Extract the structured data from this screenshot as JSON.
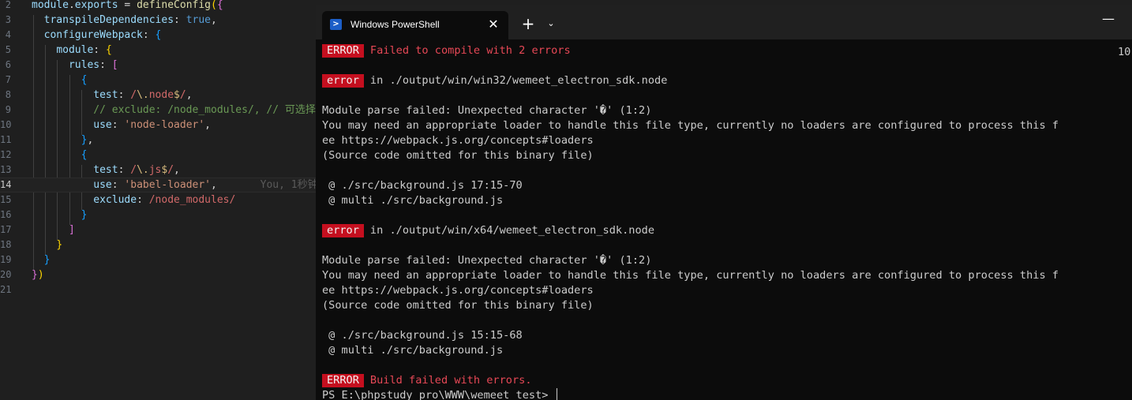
{
  "editor": {
    "lines": [
      {
        "num": "2",
        "segs": [
          [
            "tk-var",
            "module"
          ],
          [
            "tk-pun",
            "."
          ],
          [
            "tk-var",
            "exports"
          ],
          [
            "tk-pun",
            " = "
          ],
          [
            "tk-fn",
            "defineConfig"
          ],
          [
            "tk-b1",
            "("
          ],
          [
            "tk-b2",
            "{"
          ]
        ]
      },
      {
        "num": "3",
        "segs": [
          [
            "tk-pun",
            "  "
          ],
          [
            "tk-var",
            "transpileDependencies"
          ],
          [
            "tk-pun",
            ": "
          ],
          [
            "tk-kw",
            "true"
          ],
          [
            "tk-pun",
            ","
          ]
        ]
      },
      {
        "num": "4",
        "segs": [
          [
            "tk-pun",
            "  "
          ],
          [
            "tk-var",
            "configureWebpack"
          ],
          [
            "tk-pun",
            ": "
          ],
          [
            "tk-b3",
            "{"
          ]
        ]
      },
      {
        "num": "5",
        "segs": [
          [
            "tk-pun",
            "    "
          ],
          [
            "tk-var",
            "module"
          ],
          [
            "tk-pun",
            ": "
          ],
          [
            "tk-b1",
            "{"
          ]
        ]
      },
      {
        "num": "6",
        "segs": [
          [
            "tk-pun",
            "      "
          ],
          [
            "tk-var",
            "rules"
          ],
          [
            "tk-pun",
            ": "
          ],
          [
            "tk-b2",
            "["
          ]
        ]
      },
      {
        "num": "7",
        "segs": [
          [
            "tk-pun",
            "        "
          ],
          [
            "tk-b3",
            "{"
          ]
        ]
      },
      {
        "num": "8",
        "segs": [
          [
            "tk-pun",
            "          "
          ],
          [
            "tk-var",
            "test"
          ],
          [
            "tk-pun",
            ": "
          ],
          [
            "tk-re",
            "/"
          ],
          [
            "tk-esc",
            "\\."
          ],
          [
            "tk-re",
            "node"
          ],
          [
            "tk-esc",
            "$"
          ],
          [
            "tk-re",
            "/"
          ],
          [
            "tk-pun",
            ","
          ]
        ]
      },
      {
        "num": "9",
        "segs": [
          [
            "tk-pun",
            "          "
          ],
          [
            "tk-cmt",
            "// exclude: /node_modules/, // 可选择"
          ]
        ]
      },
      {
        "num": "10",
        "segs": [
          [
            "tk-pun",
            "          "
          ],
          [
            "tk-var",
            "use"
          ],
          [
            "tk-pun",
            ": "
          ],
          [
            "tk-str",
            "'node-loader'"
          ],
          [
            "tk-pun",
            ","
          ]
        ]
      },
      {
        "num": "11",
        "segs": [
          [
            "tk-pun",
            "        "
          ],
          [
            "tk-b3",
            "}"
          ],
          [
            "tk-pun",
            ","
          ]
        ]
      },
      {
        "num": "12",
        "segs": [
          [
            "tk-pun",
            "        "
          ],
          [
            "tk-b3",
            "{"
          ]
        ]
      },
      {
        "num": "13",
        "segs": [
          [
            "tk-pun",
            "          "
          ],
          [
            "tk-var",
            "test"
          ],
          [
            "tk-pun",
            ": "
          ],
          [
            "tk-re",
            "/"
          ],
          [
            "tk-esc",
            "\\."
          ],
          [
            "tk-re",
            "js"
          ],
          [
            "tk-esc",
            "$"
          ],
          [
            "tk-re",
            "/"
          ],
          [
            "tk-pun",
            ","
          ]
        ]
      },
      {
        "num": "14",
        "segs": [
          [
            "tk-pun",
            "          "
          ],
          [
            "tk-var",
            "use"
          ],
          [
            "tk-pun",
            ": "
          ],
          [
            "tk-str",
            "'babel-loader'"
          ],
          [
            "tk-pun",
            ",       "
          ],
          [
            "blame",
            "You, 1秒钟"
          ]
        ]
      },
      {
        "num": "15",
        "segs": [
          [
            "tk-pun",
            "          "
          ],
          [
            "tk-var",
            "exclude"
          ],
          [
            "tk-pun",
            ": "
          ],
          [
            "tk-re",
            "/node_modules/"
          ]
        ]
      },
      {
        "num": "16",
        "segs": [
          [
            "tk-pun",
            "        "
          ],
          [
            "tk-b3",
            "}"
          ]
        ]
      },
      {
        "num": "17",
        "segs": [
          [
            "tk-pun",
            "      "
          ],
          [
            "tk-b2",
            "]"
          ]
        ]
      },
      {
        "num": "18",
        "segs": [
          [
            "tk-pun",
            "    "
          ],
          [
            "tk-b1",
            "}"
          ]
        ]
      },
      {
        "num": "19",
        "segs": [
          [
            "tk-pun",
            "  "
          ],
          [
            "tk-b3",
            "}"
          ]
        ]
      },
      {
        "num": "20",
        "segs": [
          [
            "tk-b2",
            "}"
          ],
          [
            "tk-b1",
            ")"
          ]
        ]
      },
      {
        "num": "21",
        "segs": []
      }
    ]
  },
  "terminal": {
    "tab_title": "Windows PowerShell",
    "tab_icon": "powershell-icon",
    "close_glyph": "✕",
    "new_tab_glyph": "+",
    "dropdown_glyph": "⌄",
    "minimize_glyph": "—",
    "right_number": "10",
    "lines": [
      {
        "badge": "ERROR",
        "text": "Failed to compile with 2 errors",
        "red": true
      },
      {
        "text": ""
      },
      {
        "badge": "error",
        "text": "in ./output/win/win32/wemeet_electron_sdk.node"
      },
      {
        "text": ""
      },
      {
        "text": "Module parse failed: Unexpected character '�' (1:2)"
      },
      {
        "text": "You may need an appropriate loader to handle this file type, currently no loaders are configured to process this f"
      },
      {
        "text": "ee https://webpack.js.org/concepts#loaders"
      },
      {
        "text": "(Source code omitted for this binary file)"
      },
      {
        "text": ""
      },
      {
        "text": " @ ./src/background.js 17:15-70"
      },
      {
        "text": " @ multi ./src/background.js"
      },
      {
        "text": ""
      },
      {
        "badge": "error",
        "text": "in ./output/win/x64/wemeet_electron_sdk.node"
      },
      {
        "text": ""
      },
      {
        "text": "Module parse failed: Unexpected character '�' (1:2)"
      },
      {
        "text": "You may need an appropriate loader to handle this file type, currently no loaders are configured to process this f"
      },
      {
        "text": "ee https://webpack.js.org/concepts#loaders"
      },
      {
        "text": "(Source code omitted for this binary file)"
      },
      {
        "text": ""
      },
      {
        "text": " @ ./src/background.js 15:15-68"
      },
      {
        "text": " @ multi ./src/background.js"
      },
      {
        "text": ""
      },
      {
        "badge": "ERROR",
        "text": "Build failed with errors.",
        "red": true
      },
      {
        "prompt": "PS E:\\phpstudy_pro\\WWW\\wemeet_test> "
      }
    ]
  }
}
